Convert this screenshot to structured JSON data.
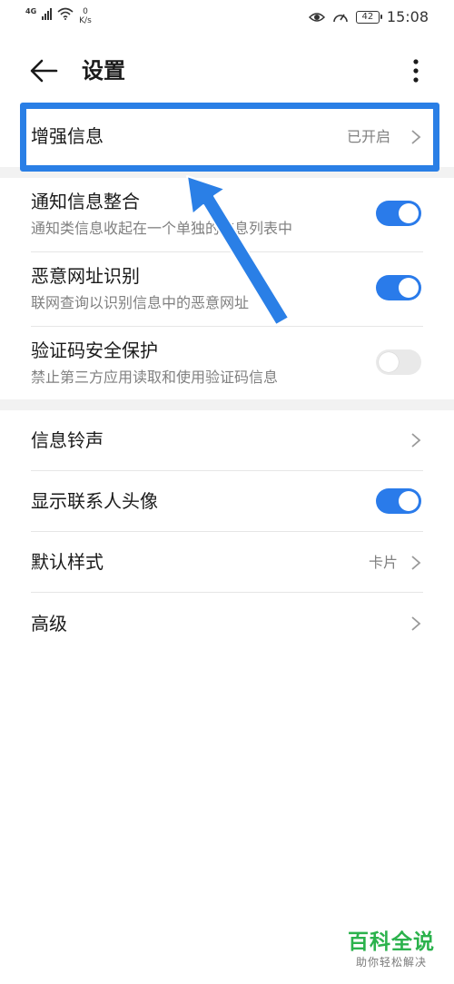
{
  "status_bar": {
    "network": "4G",
    "speed_value": "0",
    "speed_unit": "K/s",
    "battery": "42",
    "time": "15:08"
  },
  "header": {
    "title": "设置",
    "back_icon": "arrow-left-icon",
    "more_icon": "more-vertical-icon"
  },
  "enhanced": {
    "title": "增强信息",
    "value": "已开启"
  },
  "group1": [
    {
      "title": "通知信息整合",
      "subtitle": "通知类信息收起在一个单独的信息列表中",
      "toggle": true
    },
    {
      "title": "恶意网址识别",
      "subtitle": "联网查询以识别信息中的恶意网址",
      "toggle": true
    },
    {
      "title": "验证码安全保护",
      "subtitle": "禁止第三方应用读取和使用验证码信息",
      "toggle": false
    }
  ],
  "group2": [
    {
      "title": "信息铃声",
      "value": ""
    },
    {
      "title": "显示联系人头像",
      "toggle": true
    },
    {
      "title": "默认样式",
      "value": "卡片"
    },
    {
      "title": "高级",
      "value": ""
    }
  ],
  "watermark": {
    "main": "百科全说",
    "sub": "助你轻松解决"
  },
  "colors": {
    "accent": "#2a7bea",
    "highlight": "#2a7fe6",
    "watermark": "#2bb24c"
  }
}
